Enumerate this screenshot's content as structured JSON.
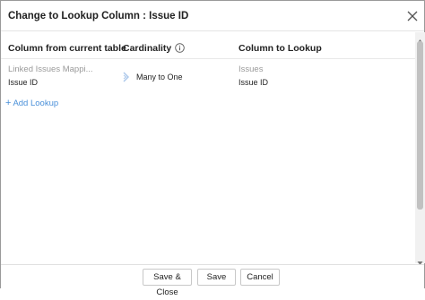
{
  "dialog": {
    "title": "Change to Lookup Column : Issue ID"
  },
  "table": {
    "headers": {
      "from": "Column from current table",
      "cardinality": "Cardinality",
      "to": "Column to Lookup"
    },
    "rows": [
      {
        "from_table": "Linked Issues Mappi...",
        "from_column": "Issue ID",
        "cardinality": "Many to One",
        "to_table": "Issues",
        "to_column": "Issue ID"
      }
    ]
  },
  "add_lookup_label": "Add Lookup",
  "footer": {
    "save_close_label": "Save & Close",
    "save_label": "Save",
    "cancel_label": "Cancel"
  },
  "colors": {
    "accent": "#4a90d9",
    "muted_text": "#9a9a9a",
    "border": "#c8c8c8"
  },
  "icons": {
    "close": "close-icon",
    "info": "info-icon",
    "cardinality": "chevron-right-icon",
    "add": "plus-icon"
  }
}
